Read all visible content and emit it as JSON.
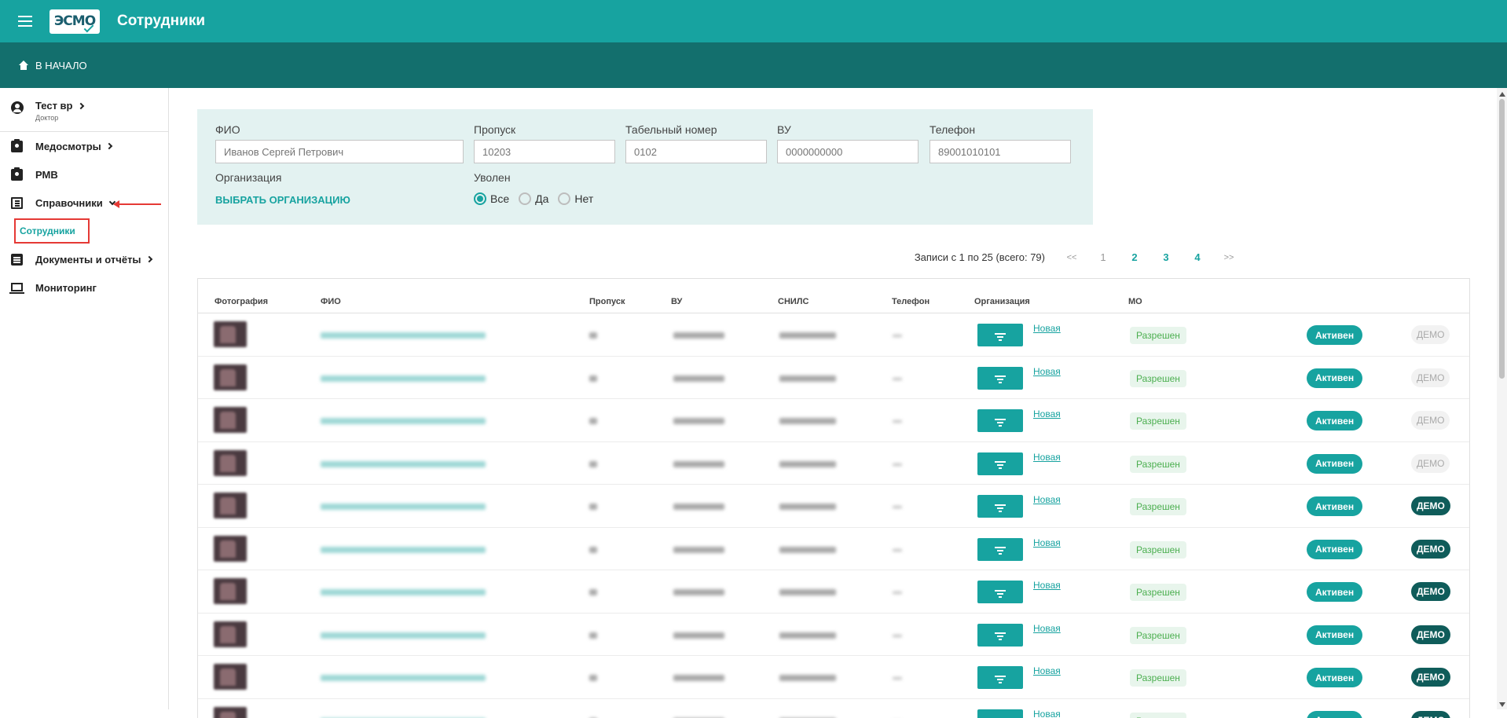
{
  "header": {
    "app_title": "Сотрудники",
    "logo_text": "ЭСМО"
  },
  "subheader": {
    "home_label": "В НАЧАЛО"
  },
  "sidebar": {
    "user": {
      "name": "Тест вр",
      "role": "Доктор"
    },
    "items": [
      {
        "label": "Медосмотры"
      },
      {
        "label": "РМВ"
      },
      {
        "label": "Справочники"
      },
      {
        "label": "Документы и отчёты"
      },
      {
        "label": "Мониторинг"
      }
    ],
    "sub_item_label": "Сотрудники"
  },
  "filters": {
    "fio": {
      "label": "ФИО",
      "placeholder": "Иванов Сергей Петрович"
    },
    "pass": {
      "label": "Пропуск",
      "placeholder": "10203"
    },
    "tab_number": {
      "label": "Табельный номер",
      "placeholder": "0102"
    },
    "vu": {
      "label": "ВУ",
      "placeholder": "0000000000"
    },
    "phone": {
      "label": "Телефон",
      "placeholder": "89001010101"
    },
    "organization": {
      "label": "Организация",
      "select_label": "ВЫБРАТЬ ОРГАНИЗАЦИЮ"
    },
    "fired": {
      "label": "Уволен",
      "options": [
        "Все",
        "Да",
        "Нет"
      ],
      "selected": "Все"
    }
  },
  "pagination": {
    "info": "Записи с 1 по 25 (всего: 79)",
    "first": "<<",
    "pages": [
      "1",
      "2",
      "3",
      "4"
    ],
    "current": "1",
    "last": ">>"
  },
  "table": {
    "columns": [
      "Фотография",
      "ФИО",
      "Пропуск",
      "ВУ",
      "СНИЛС",
      "Телефон",
      "Организация",
      "МО"
    ],
    "rows": [
      {
        "organization": "Новая",
        "mo": "Разрешен",
        "status": "Активен",
        "demo": "ДЕМО",
        "demo_active": false
      },
      {
        "organization": "Новая",
        "mo": "Разрешен",
        "status": "Активен",
        "demo": "ДЕМО",
        "demo_active": false
      },
      {
        "organization": "Новая",
        "mo": "Разрешен",
        "status": "Активен",
        "demo": "ДЕМО",
        "demo_active": false
      },
      {
        "organization": "Новая",
        "mo": "Разрешен",
        "status": "Активен",
        "demo": "ДЕМО",
        "demo_active": false
      },
      {
        "organization": "Новая",
        "mo": "Разрешен",
        "status": "Активен",
        "demo": "ДЕМО",
        "demo_active": true
      },
      {
        "organization": "Новая",
        "mo": "Разрешен",
        "status": "Активен",
        "demo": "ДЕМО",
        "demo_active": true
      },
      {
        "organization": "Новая",
        "mo": "Разрешен",
        "status": "Активен",
        "demo": "ДЕМО",
        "demo_active": true
      },
      {
        "organization": "Новая",
        "mo": "Разрешен",
        "status": "Активен",
        "demo": "ДЕМО",
        "demo_active": true
      },
      {
        "organization": "Новая",
        "mo": "Разрешен",
        "status": "Активен",
        "demo": "ДЕМО",
        "demo_active": true
      },
      {
        "organization": "Новая",
        "mo": "Разрешен",
        "status": "Активен",
        "demo": "ДЕМО",
        "demo_active": true
      }
    ]
  },
  "colors": {
    "primary": "#17a3a0",
    "header_dark": "#136f6d",
    "filter_bg": "#e3f2f1",
    "demo_active": "#0f5c5a",
    "highlight_red": "#e53935"
  }
}
